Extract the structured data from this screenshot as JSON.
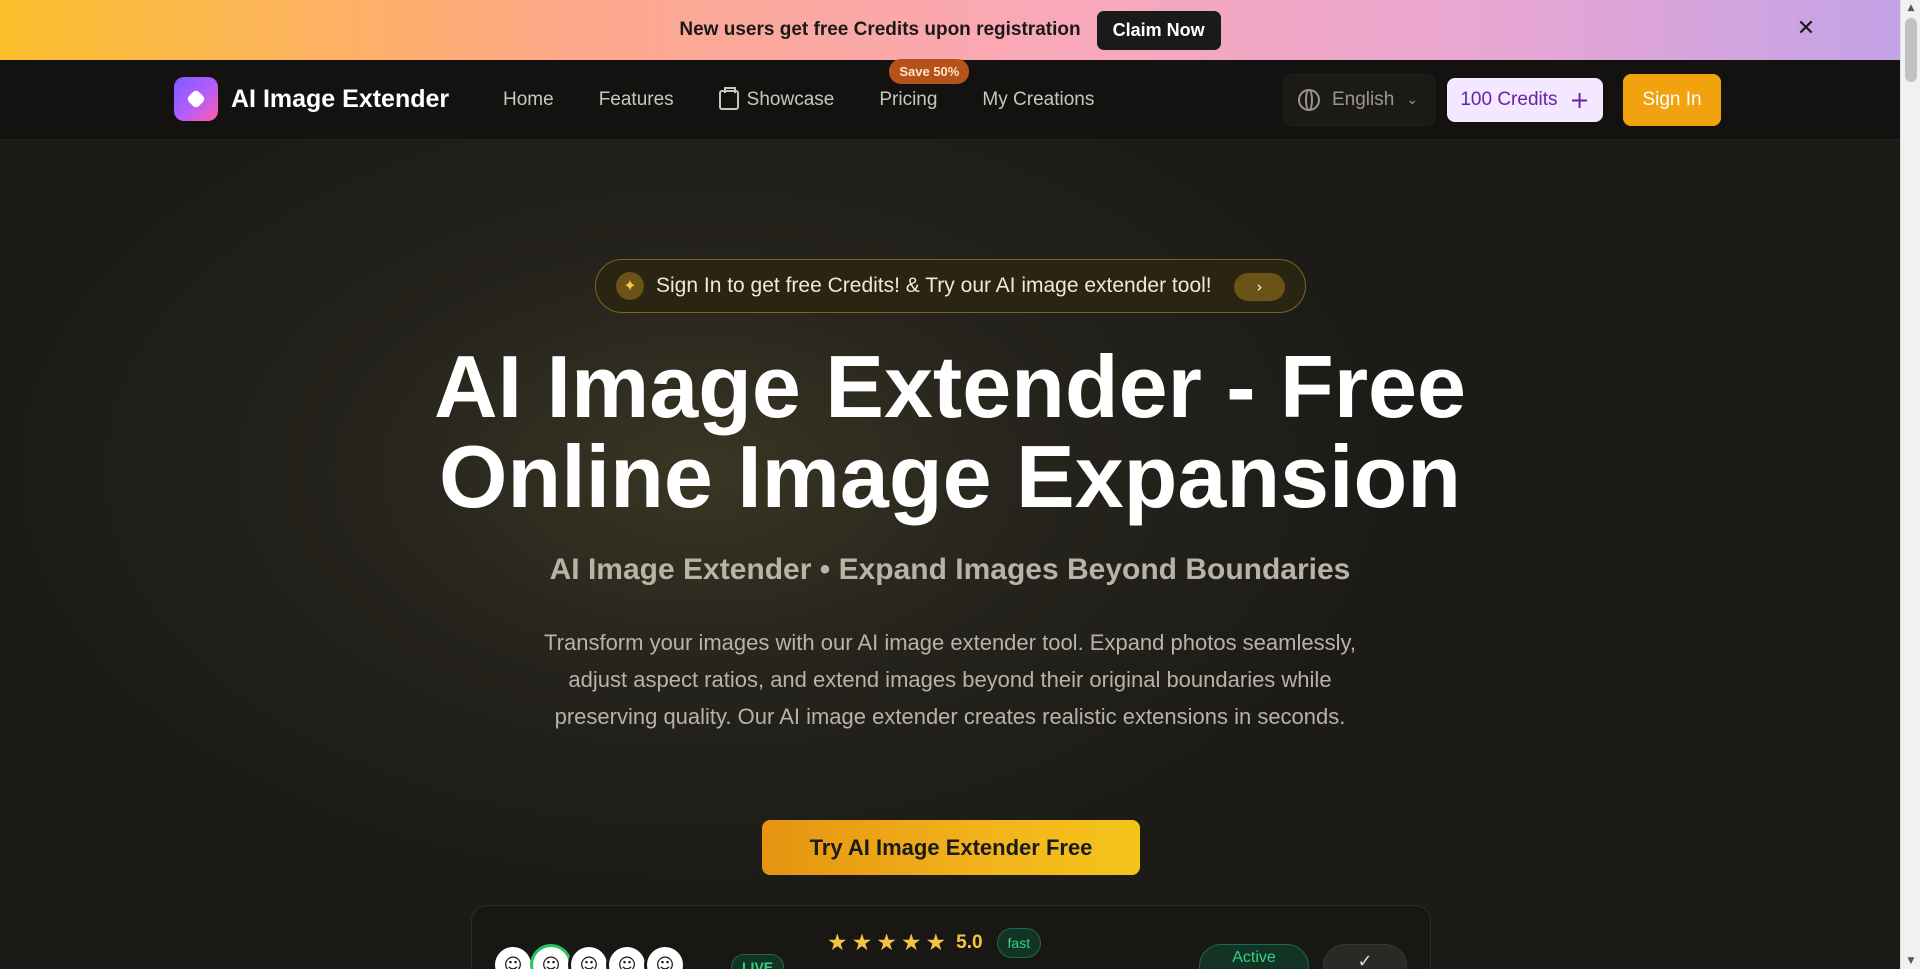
{
  "promo": {
    "text": "New users get free Credits upon registration",
    "button": "Claim Now",
    "close_icon": "✕"
  },
  "nav": {
    "brand": "AI Image Extender",
    "links": [
      "Home",
      "Features",
      "Showcase",
      "Pricing",
      "My Creations"
    ],
    "save_badge": "Save 50%",
    "language": "English",
    "credits": "100 Credits",
    "signin": "Sign In"
  },
  "hero": {
    "pill_text": "Sign In to get free Credits! & Try our AI image extender tool!",
    "pill_arrow": "›",
    "headline_line1": "AI Image Extender - Free",
    "headline_line2": "Online Image Expansion",
    "subhead": "AI Image Extender • Expand Images Beyond Boundaries",
    "description": "Transform your images with our AI image extender tool. Expand photos seamlessly, adjust aspect ratios, and extend images beyond their original boundaries while preserving quality. Our AI image extender creates realistic extensions in seconds.",
    "cta": "Try AI Image Extender Free"
  },
  "stats": {
    "live": "LIVE",
    "rating": "5.0",
    "fast": "fast",
    "active": "Active",
    "check": "✓",
    "stars": 5
  },
  "colors": {
    "accent": "#f2a20e",
    "credits_bg": "#f3e8ff",
    "credits_text": "#6b21a8"
  },
  "icons": {
    "logo": "logo-icon",
    "showcase": "calendar-icon",
    "language": "globe-icon",
    "credits": "plus-icon",
    "pill": "sparkle-icon"
  }
}
